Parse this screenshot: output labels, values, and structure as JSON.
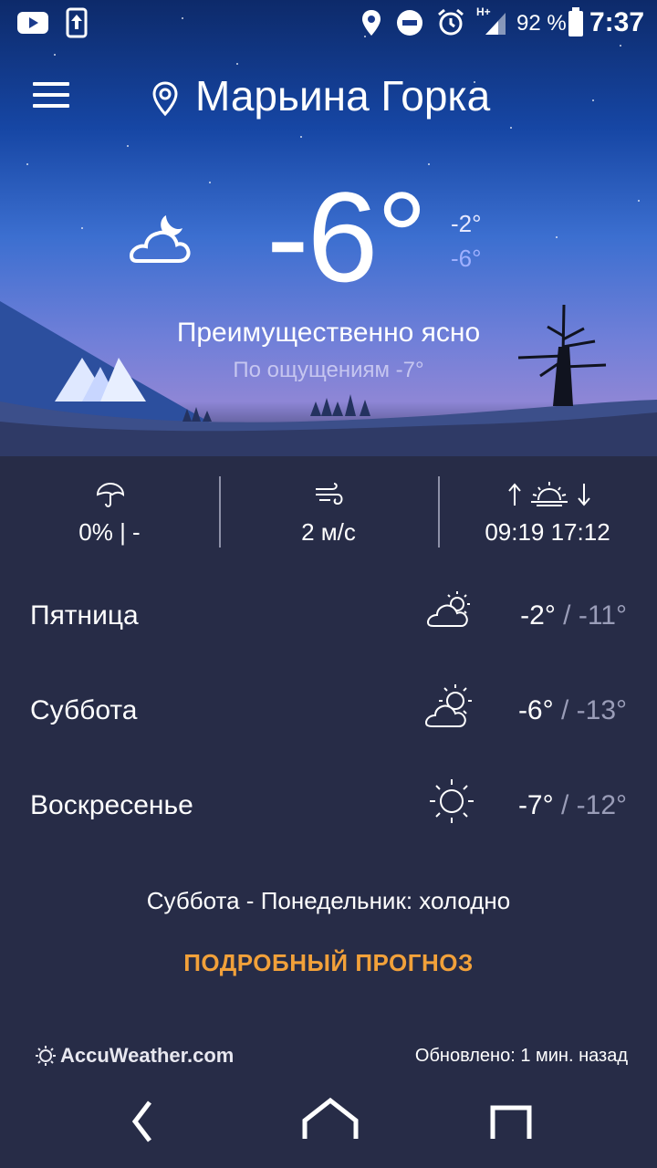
{
  "status_bar": {
    "battery": "92 %",
    "network": "H+",
    "time": "7:37",
    "icons": [
      "youtube-icon",
      "upload-icon",
      "location-icon",
      "do-not-disturb-icon",
      "alarm-icon",
      "signal-icon",
      "battery-icon"
    ]
  },
  "header": {
    "city": "Марьина Горка",
    "menu_icon": "hamburger-menu-icon",
    "pin_icon": "location-pin-icon"
  },
  "current": {
    "temp": "-6°",
    "high": "-2°",
    "low": "-6°",
    "condition": "Преимущественно ясно",
    "feels_like": "По ощущениям -7°",
    "icon": "cloud-moon-icon"
  },
  "stats": {
    "precip": "0% | -",
    "wind": "2 м/с",
    "sunrise": "09:19",
    "sunset": "17:12",
    "sun_times": "09:19  17:12"
  },
  "forecast": [
    {
      "day": "Пятница",
      "icon": "partly-cloudy-icon",
      "high": "-2°",
      "sep": "/",
      "low": "-11°"
    },
    {
      "day": "Суббота",
      "icon": "partly-sunny-icon",
      "high": "-6°",
      "sep": "/",
      "low": "-13°"
    },
    {
      "day": "Воскресенье",
      "icon": "sun-icon",
      "high": "-7°",
      "sep": "/",
      "low": "-12°"
    }
  ],
  "summary": "Суббота - Понедельник: холодно",
  "detail_link": "ПОДРОБНЫЙ ПРОГНОЗ",
  "footer": {
    "brand": "AccuWeather.com",
    "updated": "Обновлено: 1 мин. назад"
  },
  "colors": {
    "background": "#272c47",
    "accent": "#f2a13a",
    "secondary_text": "#9a9db8"
  }
}
